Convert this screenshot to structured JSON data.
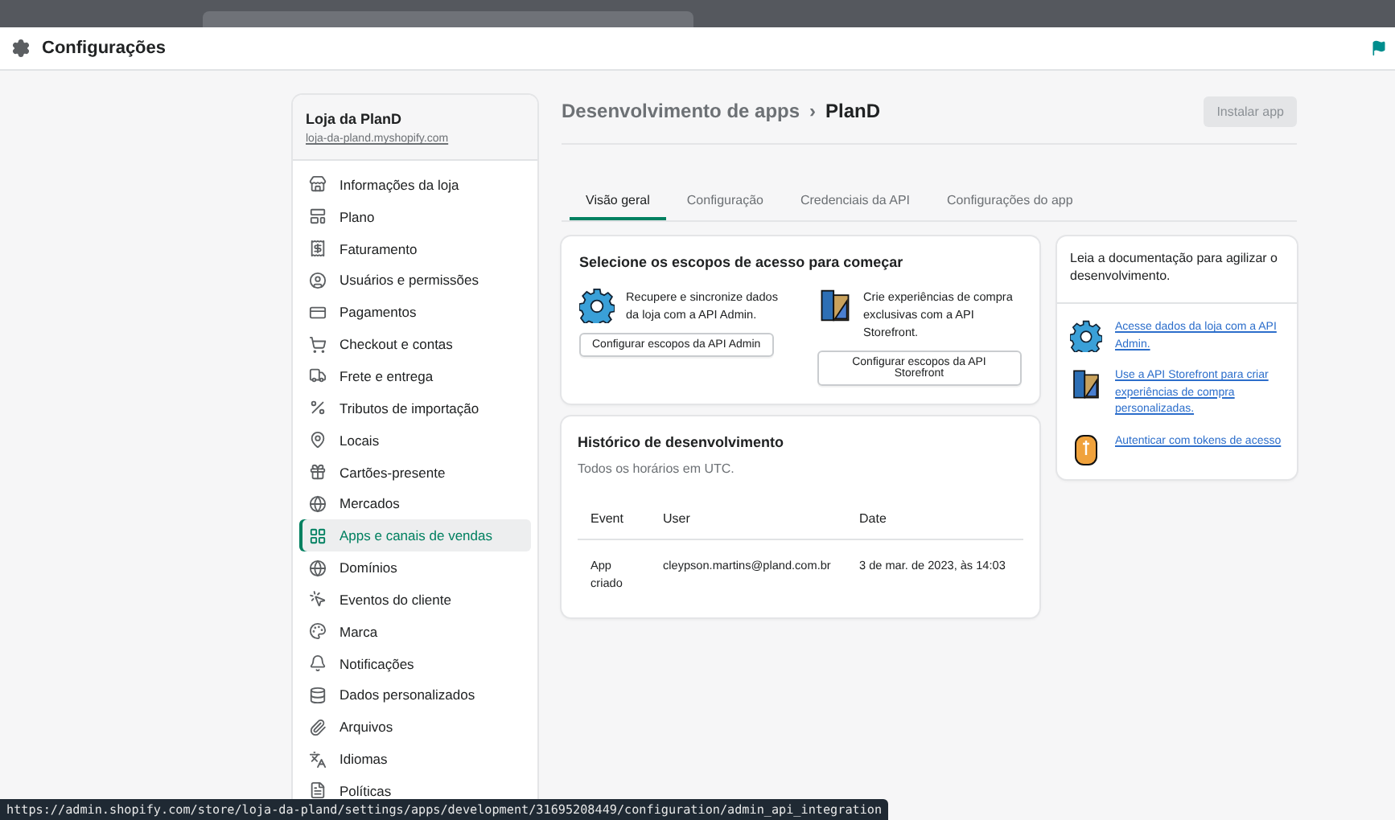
{
  "modal": {
    "title": "Configurações"
  },
  "store": {
    "name": "Loja da PlanD",
    "domain": "loja-da-pland.myshopify.com"
  },
  "sidebar": {
    "items": [
      {
        "label": "Informações da loja",
        "selected": false
      },
      {
        "label": "Plano",
        "selected": false
      },
      {
        "label": "Faturamento",
        "selected": false
      },
      {
        "label": "Usuários e permissões",
        "selected": false
      },
      {
        "label": "Pagamentos",
        "selected": false
      },
      {
        "label": "Checkout e contas",
        "selected": false
      },
      {
        "label": "Frete e entrega",
        "selected": false
      },
      {
        "label": "Tributos de importação",
        "selected": false
      },
      {
        "label": "Locais",
        "selected": false
      },
      {
        "label": "Cartões-presente",
        "selected": false
      },
      {
        "label": "Mercados",
        "selected": false
      },
      {
        "label": "Apps e canais de vendas",
        "selected": true
      },
      {
        "label": "Domínios",
        "selected": false
      },
      {
        "label": "Eventos do cliente",
        "selected": false
      },
      {
        "label": "Marca",
        "selected": false
      },
      {
        "label": "Notificações",
        "selected": false
      },
      {
        "label": "Dados personalizados",
        "selected": false
      },
      {
        "label": "Arquivos",
        "selected": false
      },
      {
        "label": "Idiomas",
        "selected": false
      },
      {
        "label": "Políticas",
        "selected": false
      }
    ]
  },
  "breadcrumb": {
    "parent": "Desenvolvimento de apps",
    "separator": "›",
    "current": "PlanD"
  },
  "install_button": {
    "label": "Instalar app",
    "disabled": true
  },
  "tabs": [
    {
      "label": "Visão geral",
      "selected": true
    },
    {
      "label": "Configuração",
      "selected": false
    },
    {
      "label": "Credenciais da API",
      "selected": false
    },
    {
      "label": "Configurações do app",
      "selected": false
    }
  ],
  "scopes_card": {
    "title": "Selecione os escopos de acesso para começar",
    "options": [
      {
        "text": "Recupere e sincronize dados da loja com a API Admin.",
        "button": "Configurar escopos da API Admin"
      },
      {
        "text": "Crie experiências de compra exclusivas com a API Storefront.",
        "button": "Configurar escopos da API Storefront"
      }
    ]
  },
  "history": {
    "title": "Histórico de desenvolvimento",
    "subtitle": "Todos os horários em UTC.",
    "columns": [
      "Event",
      "User",
      "Date"
    ],
    "rows": [
      [
        "App criado",
        "cleypson.martins@pland.com.br",
        "3 de mar. de 2023, às 14:03"
      ]
    ]
  },
  "docs": {
    "intro": "Leia a documentação para agilizar o desenvolvimento.",
    "links": [
      "Acesse dados da loja com a API Admin.",
      "Use a API Storefront para criar experiências de compra personalizadas.",
      "Autenticar com tokens de acesso"
    ]
  },
  "status_url": "https://admin.shopify.com/store/loja-da-pland/settings/apps/development/31695208449/configuration/admin_api_integration"
}
